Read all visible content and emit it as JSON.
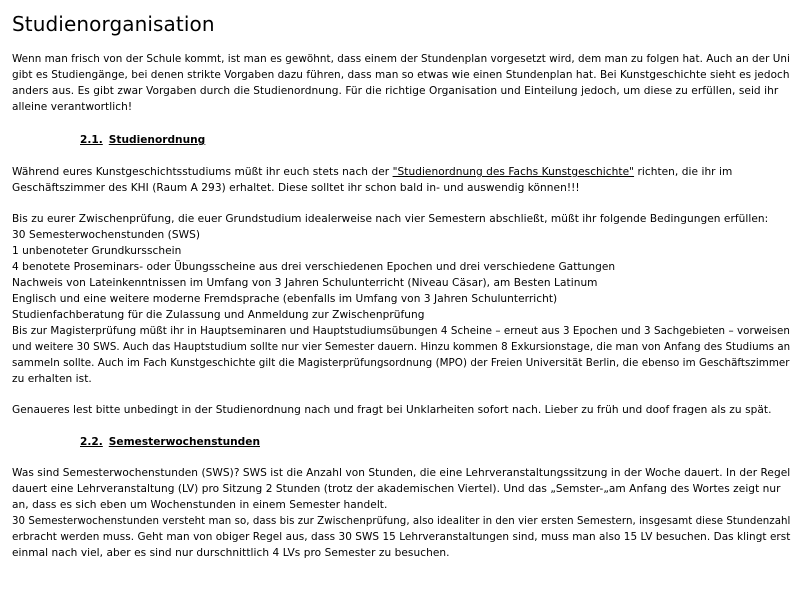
{
  "title": "Studienorganisation",
  "intro": [
    "Wenn man frisch von der Schule kommt, ist man es gewöhnt, dass einem der Stundenplan vorgesetzt wird, dem man zu folgen hat. Auch an der Uni",
    "gibt es Studiengänge, bei denen strikte Vorgaben dazu führen, dass man so etwas wie einen Stundenplan hat. Bei Kunstgeschichte sieht es jedoch",
    "anders aus. Es gibt zwar Vorgaben durch die Studienordnung. Für die richtige Organisation und Einteilung jedoch, um diese zu erfüllen, seid ihr",
    "alleine verantwortlich!"
  ],
  "section1": {
    "number": "2.1.",
    "title": "Studienordnung",
    "para1": {
      "line1_before": "Während eures Kunstgeschichtsstudiums müßt ihr euch stets nach der ",
      "line1_link": "\"Studienordnung des Fachs Kunstgeschichte\"",
      "line1_after": " richten, die ihr im",
      "line2": "Geschäftszimmer des KHI (Raum A 293) erhaltet. Diese solltet ihr schon bald in- und auswendig können!!!"
    },
    "para2": [
      "Bis zu eurer Zwischenprüfung, die euer Grundstudium idealerweise nach vier Semestern abschließt, müßt ihr folgende Bedingungen erfüllen:",
      "30 Semesterwochenstunden (SWS)",
      "1 unbenoteter Grundkursschein",
      "4 benotete Proseminars- oder Übungsscheine aus drei verschiedenen Epochen und drei verschiedene Gattungen",
      "Nachweis von Lateinkenntnissen im Umfang von 3 Jahren Schulunterricht (Niveau Cäsar), am Besten Latinum",
      "Englisch und eine weitere moderne Fremdsprache (ebenfalls im Umfang von 3 Jahren Schulunterricht)",
      "Studienfachberatung für die Zulassung und Anmeldung zur Zwischenprüfung",
      "Bis zur Magisterprüfung müßt ihr in Hauptseminaren und Hauptstudiumsübungen 4 Scheine – erneut aus 3 Epochen und 3 Sachgebieten – vorweisen",
      "und weitere 30 SWS. Auch das Hauptstudium sollte nur vier Semester dauern. Hinzu kommen 8 Exkursionstage, die man von Anfang des Studiums an",
      "sammeln sollte. Auch im Fach Kunstgeschichte gilt die Magisterprüfungsordnung (MPO) der Freien Universität Berlin, die ebenso im Geschäftszimmer",
      "zu erhalten ist."
    ],
    "para3": "Genaueres lest bitte unbedingt in der Studienordnung nach und fragt bei Unklarheiten sofort nach. Lieber zu früh und doof fragen als zu spät."
  },
  "section2": {
    "number": "2.2.",
    "title": "Semesterwochenstunden",
    "para1": [
      "Was sind Semesterwochenstunden (SWS)? SWS ist die Anzahl von Stunden, die eine Lehrveranstaltungssitzung in der Woche dauert. In der Regel",
      "dauert eine Lehrveranstaltung (LV) pro Sitzung 2 Stunden (trotz der akademischen Viertel). Und das „Semster-„am Anfang des Wortes zeigt nur",
      "an, dass es sich eben um Wochenstunden in einem Semester handelt.",
      "30 Semesterwochenstunden versteht man so, dass bis zur Zwischenprüfung, also idealiter in den vier ersten Semestern, insgesamt diese Stundenzahl",
      "erbracht werden muss. Geht man von obiger Regel aus, dass 30 SWS 15 Lehrveranstaltungen sind, muss man also 15 LV besuchen. Das klingt erst",
      "einmal nach viel, aber es sind nur durschnittlich 4 LVs pro Semester zu besuchen."
    ]
  }
}
